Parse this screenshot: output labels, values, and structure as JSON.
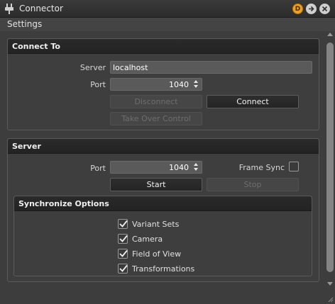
{
  "window": {
    "title": "Connector"
  },
  "menu": {
    "settings": "Settings"
  },
  "titlebar_buttons": {
    "d_label": "D"
  },
  "connect_to": {
    "title": "Connect To",
    "server_label": "Server",
    "server_value": "localhost",
    "port_label": "Port",
    "port_value": "1040",
    "disconnect_label": "Disconnect",
    "connect_label": "Connect",
    "take_over_label": "Take Over Control"
  },
  "server": {
    "title": "Server",
    "port_label": "Port",
    "port_value": "1040",
    "frame_sync_label": "Frame Sync",
    "frame_sync_checked": false,
    "start_label": "Start",
    "stop_label": "Stop"
  },
  "sync_options": {
    "title": "Synchronize Options",
    "items": [
      {
        "label": "Variant Sets",
        "checked": true
      },
      {
        "label": "Camera",
        "checked": true
      },
      {
        "label": "Field of View",
        "checked": true
      },
      {
        "label": "Transformations",
        "checked": true
      }
    ]
  },
  "colors": {
    "accent_d": "#f0a020",
    "background": "#3d3d3d",
    "header": "#252525"
  }
}
